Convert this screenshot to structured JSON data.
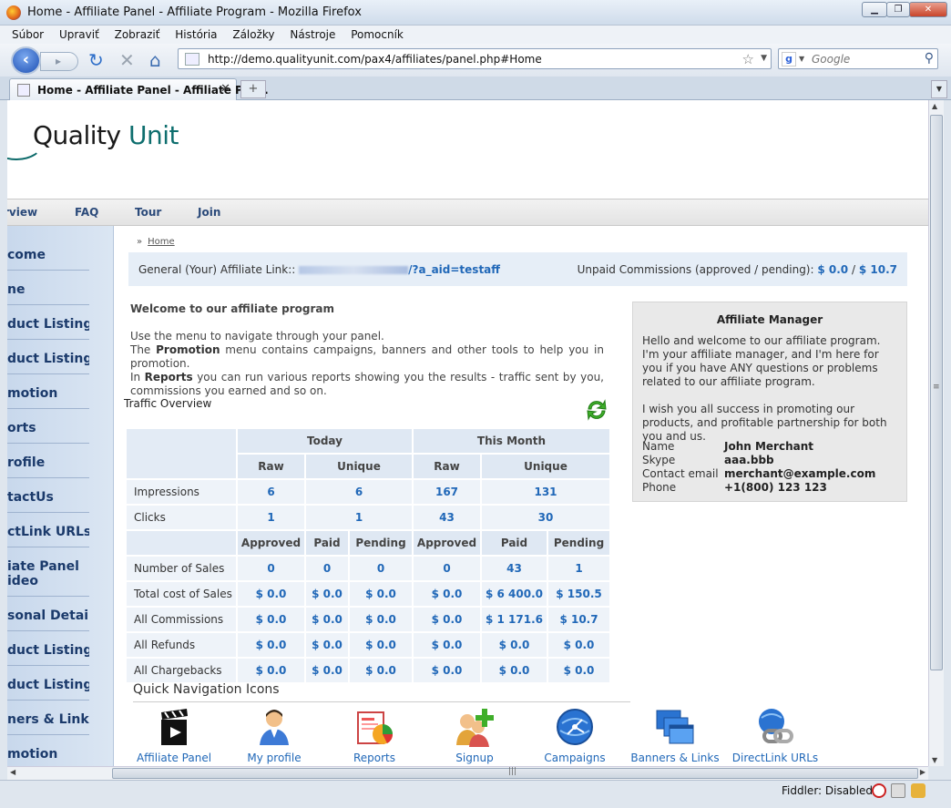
{
  "window": {
    "title": "Home - Affiliate Panel - Affiliate Program - Mozilla Firefox",
    "min_label": "▁",
    "max_label": "❐",
    "close_label": "✕"
  },
  "menubar": [
    "Súbor",
    "Upraviť",
    "Zobraziť",
    "História",
    "Záložky",
    "Nástroje",
    "Pomocník"
  ],
  "navbar": {
    "url": "http://demo.qualityunit.com/pax4/affiliates/panel.php#Home",
    "search_placeholder": "Google"
  },
  "tabs": [
    {
      "label": "Home - Affiliate Panel - Affiliate Pro..."
    }
  ],
  "page": {
    "logo": {
      "part1": "Quality ",
      "part2": "Unit"
    },
    "topnav": [
      "rview",
      "FAQ",
      "Tour",
      "Join"
    ],
    "sidebar": [
      "come",
      "ne",
      "duct Listing",
      "duct Listing",
      "motion",
      "orts",
      "rofile",
      "tactUs",
      "ctLink URLs",
      "iate Panel ideo",
      "sonal Details",
      "duct Listing",
      "duct Listing",
      "ners & Links",
      "motion"
    ],
    "breadcrumb": {
      "sep": "»",
      "home": "Home"
    },
    "affiliate_bar": {
      "label": "General (Your) Affiliate Link::",
      "link_suffix": "/?a_aid=testaff",
      "unpaid_label": "Unpaid Commissions (approved / pending):",
      "approved": "$ 0.0",
      "slash": "/",
      "pending": "$ 10.7"
    },
    "welcome": {
      "heading": "Welcome to our affiliate program",
      "line1": "Use the menu to navigate through your panel.",
      "line2_pre": "The ",
      "line2_bold": "Promotion",
      "line2_post": " menu contains campaigns, banners and other tools to help you in promotion.",
      "line3_pre": "In ",
      "line3_bold": "Reports",
      "line3_post": " you can run various reports showing you the results - traffic sent by you, commissions you earned and so on."
    },
    "manager": {
      "title": "Affiliate Manager",
      "p1": "Hello and welcome to our affiliate program.",
      "p2": "I'm your affiliate manager, and I'm here for you if you have ANY questions or problems related to our affiliate program.",
      "p3": "I wish you all success in promoting our products, and profitable partnership for both you and us.",
      "name_label": "Name",
      "name": "John Merchant",
      "skype_label": "Skype",
      "skype": "aaa.bbb",
      "email_label": "Contact email",
      "email": "merchant@example.com",
      "phone_label": "Phone",
      "phone": "+1(800) 123 123"
    },
    "traffic": {
      "title": "Traffic Overview",
      "today": "Today",
      "month": "This Month",
      "raw": "Raw",
      "unique": "Unique",
      "approved": "Approved",
      "paid": "Paid",
      "pending": "Pending",
      "rows1": [
        {
          "label": "Impressions",
          "vals": [
            "6",
            "6",
            "167",
            "131"
          ]
        },
        {
          "label": "Clicks",
          "vals": [
            "1",
            "1",
            "43",
            "30"
          ]
        }
      ],
      "rows2": [
        {
          "label": "Number of Sales",
          "vals": [
            "0",
            "0",
            "0",
            "0",
            "43",
            "1"
          ]
        },
        {
          "label": "Total cost of Sales",
          "vals": [
            "$ 0.0",
            "$ 0.0",
            "$ 0.0",
            "$ 0.0",
            "$ 6 400.0",
            "$ 150.5"
          ]
        },
        {
          "label": "All Commissions",
          "vals": [
            "$ 0.0",
            "$ 0.0",
            "$ 0.0",
            "$ 0.0",
            "$ 1 171.6",
            "$ 10.7"
          ]
        },
        {
          "label": "All Refunds",
          "vals": [
            "$ 0.0",
            "$ 0.0",
            "$ 0.0",
            "$ 0.0",
            "$ 0.0",
            "$ 0.0"
          ]
        },
        {
          "label": "All Chargebacks",
          "vals": [
            "$ 0.0",
            "$ 0.0",
            "$ 0.0",
            "$ 0.0",
            "$ 0.0",
            "$ 0.0"
          ]
        }
      ]
    },
    "quicknav": {
      "title": "Quick Navigation Icons",
      "items": [
        "Affiliate Panel",
        "My profile",
        "Reports",
        "Signup",
        "Campaigns",
        "Banners & Links",
        "DirectLink URLs"
      ]
    }
  },
  "statusbar": {
    "fiddler": "Fiddler: Disabled"
  }
}
